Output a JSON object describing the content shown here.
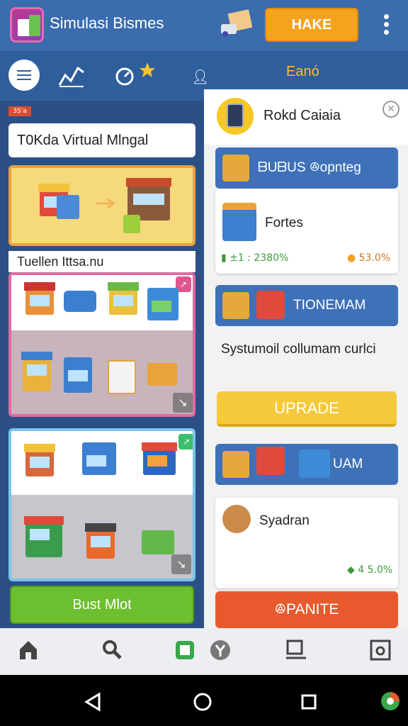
{
  "header": {
    "app_title": "Simulasi Bismes",
    "make_button": "HAKE"
  },
  "nav": {
    "right_label": "Eanó"
  },
  "left": {
    "promo_badge": "3S'a",
    "search_value": "T0Kda Virtual Mlngal",
    "section_label": "Tuellen Ittsa.nu",
    "action_button": "Bust Mlot"
  },
  "right": {
    "title": "Rokd Caiaia",
    "card1_header": "ᗷUᗷUS ꔮopnteg",
    "card1_item": "Fortes",
    "card1_stat_left": "±1 : 2380%",
    "card1_stat_right": "53.0%",
    "card2_header": "TIONEMAM",
    "description": "Systumoil collumam curlci",
    "upgrade_button": "UPRADE",
    "card3_header": "UAM",
    "card4_item": "Syadran",
    "card4_stat": "4 5.0%",
    "upgrade2_button": "ꔮPANITE"
  },
  "colors": {
    "accent": "#3a6cae",
    "make": "#f5a21c",
    "upgrade": "#f5c93a",
    "danger": "#e85a2e",
    "go": "#6cbf2e"
  }
}
